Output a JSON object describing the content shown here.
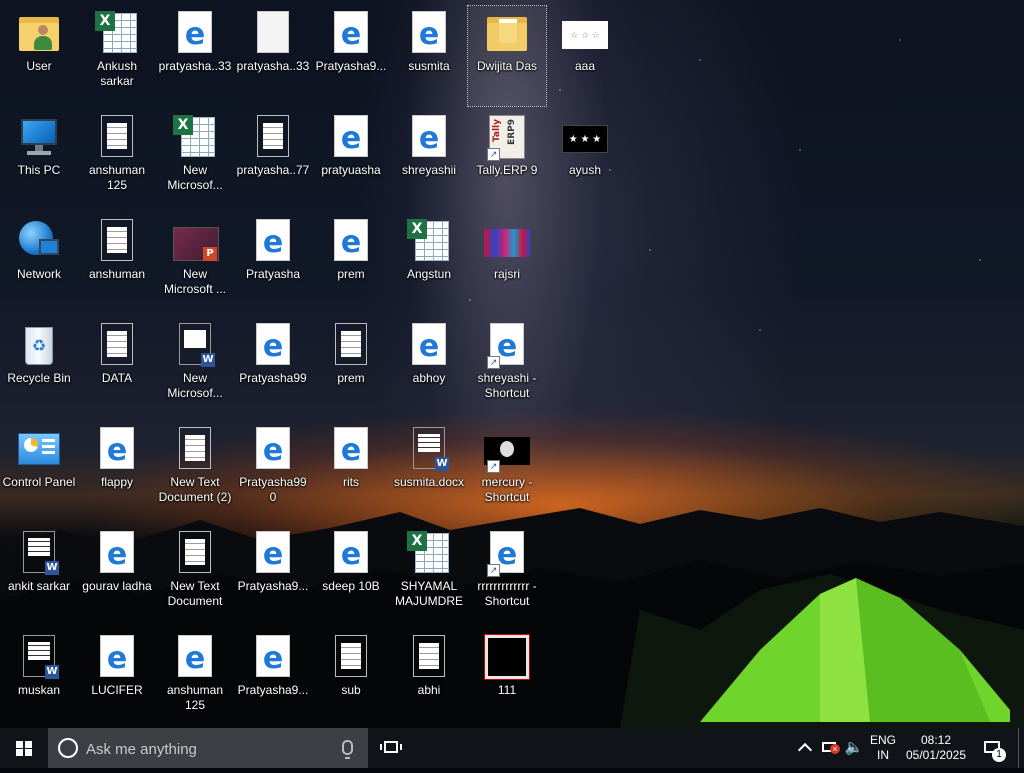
{
  "desktop": {
    "icons": [
      {
        "label": "User",
        "kind": "folder-user"
      },
      {
        "label": "Ankush sarkar",
        "kind": "excel"
      },
      {
        "label": "pratyasha..33",
        "kind": "edge"
      },
      {
        "label": "pratyasha..33",
        "kind": "blank"
      },
      {
        "label": "Pratyasha9...",
        "kind": "edge"
      },
      {
        "label": "susmita",
        "kind": "edge"
      },
      {
        "label": "Dwijita Das",
        "kind": "folder-doc",
        "selected": true
      },
      {
        "label": "aaa",
        "kind": "img-white"
      },
      {
        "label": "This PC",
        "kind": "thispc"
      },
      {
        "label": "anshuman 125",
        "kind": "text"
      },
      {
        "label": "New Microsof...",
        "kind": "excel"
      },
      {
        "label": "pratyasha..77",
        "kind": "text"
      },
      {
        "label": "pratyuasha",
        "kind": "edge"
      },
      {
        "label": "shreyashii",
        "kind": "edge"
      },
      {
        "label": "Tally.ERP 9",
        "kind": "tally",
        "shortcut": true
      },
      {
        "label": "ayush",
        "kind": "img-black"
      },
      {
        "label": "Network",
        "kind": "network"
      },
      {
        "label": "anshuman",
        "kind": "text"
      },
      {
        "label": "New Microsoft ...",
        "kind": "ppt"
      },
      {
        "label": "Pratyasha",
        "kind": "edge"
      },
      {
        "label": "prem",
        "kind": "edge"
      },
      {
        "label": "Angstun",
        "kind": "excel"
      },
      {
        "label": "rajsri",
        "kind": "img-rajsri"
      },
      {
        "label": "Recycle Bin",
        "kind": "recycle"
      },
      {
        "label": "DATA",
        "kind": "text"
      },
      {
        "label": "New Microsof...",
        "kind": "word-blank"
      },
      {
        "label": "Pratyasha99",
        "kind": "edge"
      },
      {
        "label": "prem",
        "kind": "text"
      },
      {
        "label": "abhoy",
        "kind": "edge"
      },
      {
        "label": "shreyashi - Shortcut",
        "kind": "edge",
        "shortcut": true
      },
      {
        "label": "Control Panel",
        "kind": "control"
      },
      {
        "label": "flappy",
        "kind": "edge"
      },
      {
        "label": "New Text Document (2)",
        "kind": "text"
      },
      {
        "label": "Pratyasha990",
        "kind": "edge"
      },
      {
        "label": "rits",
        "kind": "edge"
      },
      {
        "label": "susmita.docx",
        "kind": "word"
      },
      {
        "label": "mercury - Shortcut",
        "kind": "img-mercury",
        "shortcut": true
      },
      {
        "label": "ankit sarkar",
        "kind": "word"
      },
      {
        "label": "gourav ladha",
        "kind": "edge"
      },
      {
        "label": "New Text Document",
        "kind": "text"
      },
      {
        "label": "Pratyasha9...",
        "kind": "edge"
      },
      {
        "label": "sdeep 10B",
        "kind": "edge"
      },
      {
        "label": "SHYAMAL MAJUMDRE",
        "kind": "excel"
      },
      {
        "label": "rrrrrrrrrrrrr - Shortcut",
        "kind": "edge",
        "shortcut": true
      },
      {
        "label": "muskan",
        "kind": "word"
      },
      {
        "label": "LUCIFER",
        "kind": "edge"
      },
      {
        "label": "anshuman 125",
        "kind": "edge"
      },
      {
        "label": "Pratyasha9...",
        "kind": "edge"
      },
      {
        "label": "sub",
        "kind": "text"
      },
      {
        "label": "abhi",
        "kind": "text"
      },
      {
        "label": "111",
        "kind": "img-redframe"
      }
    ]
  },
  "taskbar": {
    "search_placeholder": "Ask me anything",
    "language_top": "ENG",
    "language_bottom": "IN",
    "time": "08:12",
    "date": "05/01/2025",
    "notification_count": "1"
  },
  "colors": {
    "taskbar_bg": "#101418",
    "search_bg": "#3d3f44",
    "edge_blue": "#1e7ad6",
    "excel_green": "#1f7244",
    "word_blue": "#2b579a"
  }
}
